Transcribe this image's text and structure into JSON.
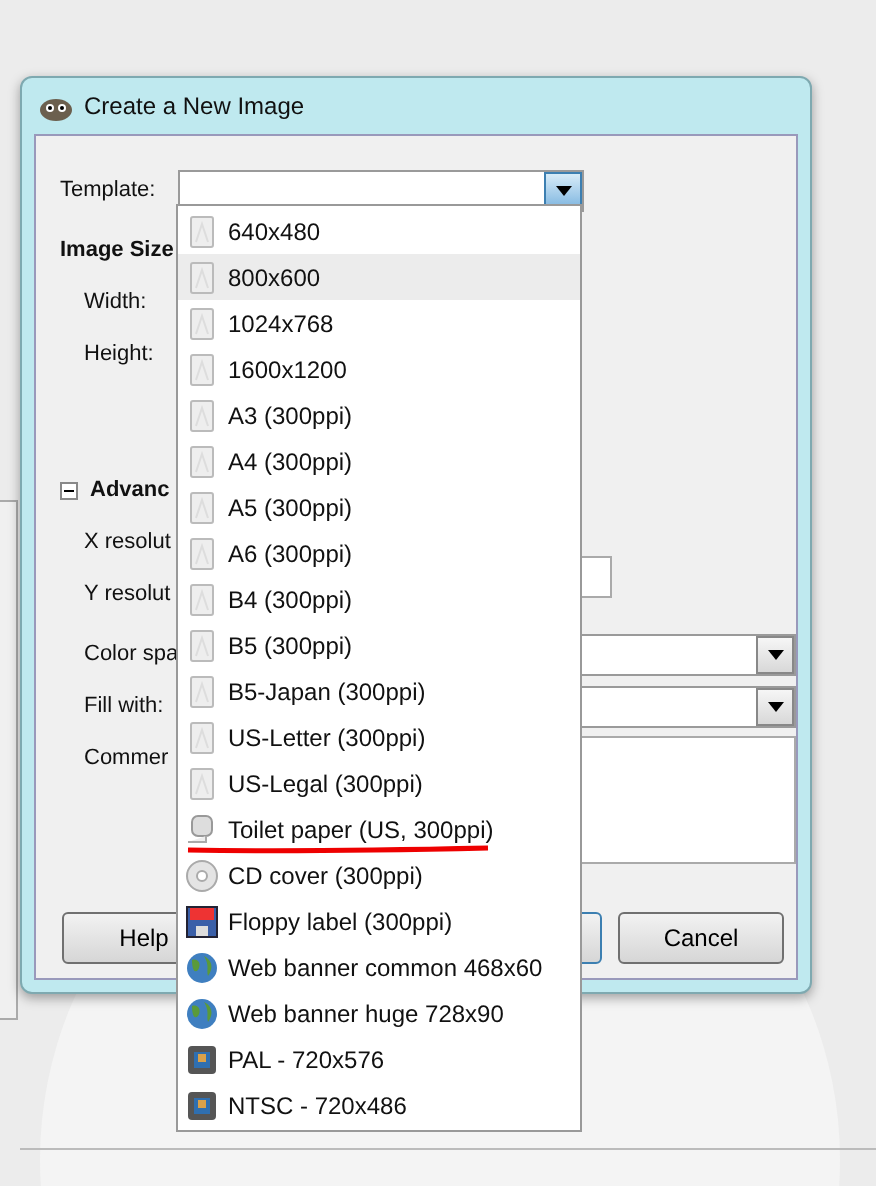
{
  "window": {
    "title": "Create a New Image"
  },
  "form": {
    "template_label": "Template:",
    "image_size_heading": "Image Size",
    "width_label": "Width:",
    "height_label": "Height:",
    "advanced": {
      "label": "Advanc",
      "expanded": true
    },
    "x_resolution_label": "X resolut",
    "y_resolution_label": "Y resolut",
    "color_space_label": "Color spa",
    "fill_label": "Fill with:",
    "comment_label": "Commer"
  },
  "buttons": {
    "help": "Help",
    "cancel": "Cancel"
  },
  "template_menu": [
    {
      "label": "640x480",
      "kind": "page",
      "selected": false,
      "annotated": false
    },
    {
      "label": "800x600",
      "kind": "page",
      "selected": true,
      "annotated": false
    },
    {
      "label": "1024x768",
      "kind": "page",
      "selected": false,
      "annotated": false
    },
    {
      "label": "1600x1200",
      "kind": "page",
      "selected": false,
      "annotated": false
    },
    {
      "label": "A3 (300ppi)",
      "kind": "page",
      "selected": false,
      "annotated": false
    },
    {
      "label": "A4 (300ppi)",
      "kind": "page",
      "selected": false,
      "annotated": false
    },
    {
      "label": "A5 (300ppi)",
      "kind": "page",
      "selected": false,
      "annotated": false
    },
    {
      "label": "A6 (300ppi)",
      "kind": "page",
      "selected": false,
      "annotated": false
    },
    {
      "label": "B4 (300ppi)",
      "kind": "page",
      "selected": false,
      "annotated": false
    },
    {
      "label": "B5 (300ppi)",
      "kind": "page",
      "selected": false,
      "annotated": false
    },
    {
      "label": "B5-Japan (300ppi)",
      "kind": "page",
      "selected": false,
      "annotated": false
    },
    {
      "label": "US-Letter (300ppi)",
      "kind": "page",
      "selected": false,
      "annotated": false
    },
    {
      "label": "US-Legal (300ppi)",
      "kind": "page",
      "selected": false,
      "annotated": false
    },
    {
      "label": "Toilet paper (US, 300ppi)",
      "kind": "roll",
      "selected": false,
      "annotated": true
    },
    {
      "label": "CD cover (300ppi)",
      "kind": "disc",
      "selected": false,
      "annotated": false
    },
    {
      "label": "Floppy label (300ppi)",
      "kind": "floppy",
      "selected": false,
      "annotated": false
    },
    {
      "label": "Web banner common 468x60",
      "kind": "globe",
      "selected": false,
      "annotated": false
    },
    {
      "label": "Web banner huge 728x90",
      "kind": "globe",
      "selected": false,
      "annotated": false
    },
    {
      "label": "PAL - 720x576",
      "kind": "video",
      "selected": false,
      "annotated": false
    },
    {
      "label": "NTSC - 720x486",
      "kind": "video",
      "selected": false,
      "annotated": false
    }
  ]
}
